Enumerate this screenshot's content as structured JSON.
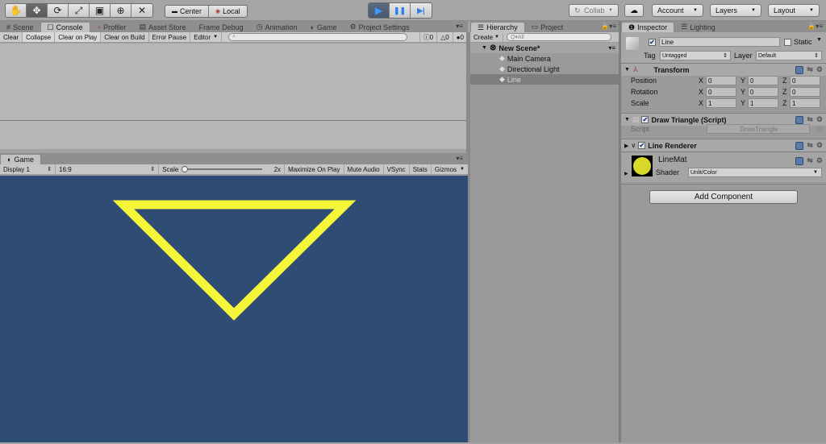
{
  "toolbar": {
    "tools": [
      {
        "name": "hand-tool",
        "glyph": "✋",
        "active": false
      },
      {
        "name": "move-tool",
        "glyph": "✥",
        "active": true
      },
      {
        "name": "rotate-tool",
        "glyph": "⟳",
        "active": false
      },
      {
        "name": "scale-tool",
        "glyph": "⤢",
        "active": false
      },
      {
        "name": "rect-tool",
        "glyph": "▣",
        "active": false
      },
      {
        "name": "transform-tool",
        "glyph": "⊕",
        "active": false
      },
      {
        "name": "custom-tool",
        "glyph": "✕",
        "active": false
      }
    ],
    "pivot_center": "Center",
    "pivot_local": "Local",
    "play_glyph": "▶",
    "pause_glyph": "❚❚",
    "step_glyph": "▶|",
    "collab": "Collab",
    "account": "Account",
    "layers": "Layers",
    "layout": "Layout"
  },
  "top_tabs": [
    {
      "icon": "#",
      "label": "Scene"
    },
    {
      "icon": "☐",
      "label": "Console",
      "active": true
    },
    {
      "icon": "◔",
      "label": "Profiler"
    },
    {
      "icon": "▤",
      "label": "Asset Store"
    },
    {
      "icon": "",
      "label": "Frame Debug"
    },
    {
      "icon": "◷",
      "label": "Animation"
    },
    {
      "icon": "◐",
      "label": "Game"
    },
    {
      "icon": "⚙",
      "label": "Project Settings"
    }
  ],
  "console_toolbar": {
    "buttons": [
      "Clear",
      "Collapse",
      "Clear on Play",
      "Clear on Build",
      "Error Pause",
      "Editor"
    ],
    "search_placeholder": "",
    "info_count": "0",
    "warn_count": "0",
    "error_count": "0"
  },
  "game_panel": {
    "tab_label": "Game",
    "display": "Display 1",
    "aspect": "16:9",
    "scale_label": "Scale",
    "scale_value": "2x",
    "scale_fraction": 0,
    "buttons": [
      "Maximize On Play",
      "Mute Audio",
      "VSync",
      "Stats",
      "Gizmos"
    ],
    "background": "#2f4c74",
    "line_color": "#f5f53a"
  },
  "hierarchy": {
    "tabs": [
      {
        "label": "Hierarchy",
        "active": true
      },
      {
        "label": "Project"
      }
    ],
    "create_label": "Create",
    "search_placeholder": "Q▾All",
    "scene_name": "New Scene*",
    "items": [
      {
        "label": "Main Camera",
        "selected": false
      },
      {
        "label": "Directional Light",
        "selected": false
      },
      {
        "label": "Line",
        "selected": true
      }
    ]
  },
  "inspector": {
    "tabs": [
      {
        "label": "Inspector",
        "active": true
      },
      {
        "label": "Lighting"
      }
    ],
    "object_name": "Line",
    "static_label": "Static",
    "tag_label": "Tag",
    "tag_value": "Untagged",
    "layer_label": "Layer",
    "layer_value": "Default",
    "transform": {
      "title": "Transform",
      "rows": [
        {
          "label": "Position",
          "x": "0",
          "y": "0",
          "z": "0"
        },
        {
          "label": "Rotation",
          "x": "0",
          "y": "0",
          "z": "0"
        },
        {
          "label": "Scale",
          "x": "1",
          "y": "1",
          "z": "1"
        }
      ]
    },
    "script_component": {
      "title": "Draw Triangle (Script)",
      "script_label": "Script",
      "script_value": "DrawTriangle"
    },
    "line_renderer": {
      "title": "Line Renderer"
    },
    "material": {
      "name": "LineMat",
      "shader_label": "Shader",
      "shader_value": "Unlit/Color",
      "color": "#d8d82a"
    },
    "add_component": "Add Component"
  }
}
